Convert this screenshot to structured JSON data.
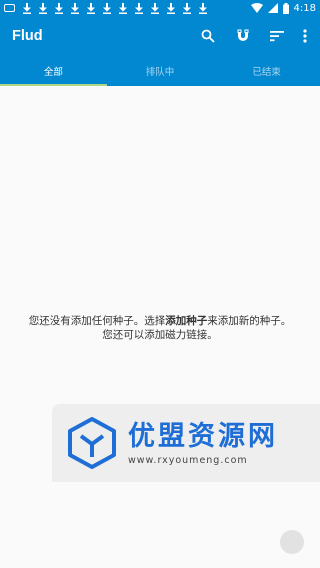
{
  "status_bar": {
    "time": "4:18",
    "download_notifications": 12
  },
  "app_bar": {
    "title": "Flud",
    "actions": [
      "search-icon",
      "magnet-icon",
      "sort-icon",
      "more-vert-icon"
    ]
  },
  "tabs": [
    {
      "label": "全部",
      "active": true
    },
    {
      "label": "排队中",
      "active": false
    },
    {
      "label": "已结束",
      "active": false
    }
  ],
  "empty_state": {
    "line1_before": "您还没有添加任何种子。选择",
    "line1_bold": "添加种子",
    "line1_after": "来添加新的种子。",
    "line2": "您还可以添加磁力链接。"
  },
  "watermark": {
    "title": "优盟资源网",
    "url": "www.rxyoumeng.com"
  },
  "colors": {
    "primary": "#0288d1",
    "tab_indicator": "#aed581",
    "watermark_blue": "#1e6ed6"
  }
}
